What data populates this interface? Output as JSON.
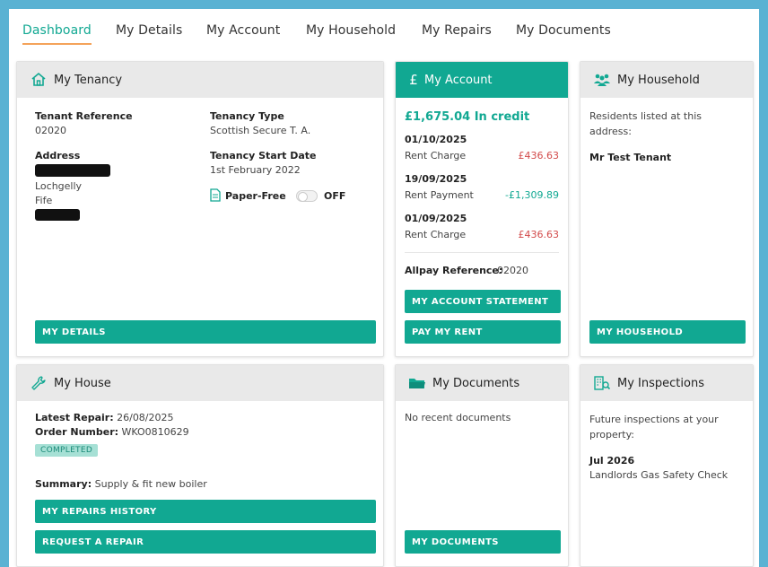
{
  "tabs": [
    {
      "label": "Dashboard"
    },
    {
      "label": "My Details"
    },
    {
      "label": "My Account"
    },
    {
      "label": "My Household"
    },
    {
      "label": "My Repairs"
    },
    {
      "label": "My Documents"
    }
  ],
  "tenancy": {
    "title": "My Tenancy",
    "tenant_reference_label": "Tenant Reference",
    "tenant_reference": "02020",
    "tenancy_type_label": "Tenancy Type",
    "tenancy_type": "Scottish Secure T. A.",
    "address_label": "Address",
    "address_line_town": "Lochgelly",
    "address_line_region": "Fife",
    "start_date_label": "Tenancy Start Date",
    "start_date": "1st February 2022",
    "paper_free_label": "Paper-Free",
    "paper_free_state": "OFF",
    "button": "MY DETAILS"
  },
  "account": {
    "title": "My Account",
    "currency_symbol": "£",
    "balance": "£1,675.04 In credit",
    "transactions": [
      {
        "date": "01/10/2025",
        "desc": "Rent Charge",
        "amount": "£436.63",
        "type": "debit"
      },
      {
        "date": "19/09/2025",
        "desc": "Rent Payment",
        "amount": "-£1,309.89",
        "type": "credit"
      },
      {
        "date": "01/09/2025",
        "desc": "Rent Charge",
        "amount": "£436.63",
        "type": "debit"
      }
    ],
    "allpay_label": "Allpay Reference:",
    "allpay_ref": "02020",
    "statement_button": "MY ACCOUNT STATEMENT",
    "pay_button": "PAY MY RENT"
  },
  "household": {
    "title": "My Household",
    "intro": "Residents listed at this address:",
    "resident": "Mr Test Tenant",
    "button": "MY HOUSEHOLD"
  },
  "house": {
    "title": "My House",
    "latest_repair_label": "Latest Repair:",
    "latest_repair": "26/08/2025",
    "order_number_label": "Order Number:",
    "order_number": "WKO0810629",
    "status_badge": "COMPLETED",
    "summary_label": "Summary:",
    "summary": "Supply & fit new boiler",
    "history_button": "MY REPAIRS HISTORY",
    "request_button": "REQUEST A REPAIR"
  },
  "documents": {
    "title": "My Documents",
    "empty_text": "No recent documents",
    "button": "MY DOCUMENTS"
  },
  "inspections": {
    "title": "My Inspections",
    "intro": "Future inspections at your property:",
    "date": "Jul 2026",
    "desc": "Landlords Gas Safety Check"
  },
  "colors": {
    "accent": "#11a892",
    "debit": "#d24a4a",
    "tab_underline": "#f4a35a",
    "frame": "#5ab2d3"
  }
}
